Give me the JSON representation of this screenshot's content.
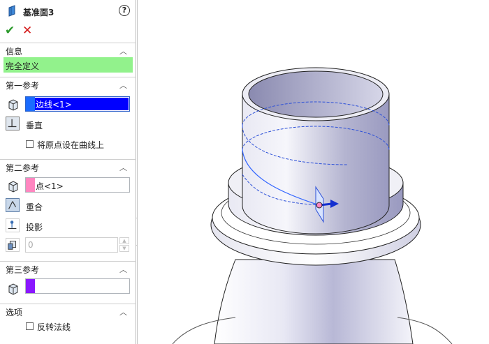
{
  "header": {
    "title": "基准面3",
    "help_icon": "?"
  },
  "actions": {
    "ok_glyph": "✔",
    "cancel_glyph": "✕"
  },
  "sections": {
    "info": {
      "label": "信息",
      "status": "完全定义",
      "status_color": "#92f28c"
    },
    "first_ref": {
      "label": "第一参考",
      "field_value": "边线<1>",
      "swatch_color": "#1a6bff",
      "field_highlight": "#0000ff",
      "constraint": "垂直",
      "checkbox_label": "将原点设在曲线上",
      "checked": false
    },
    "second_ref": {
      "label": "第二参考",
      "field_value": "点<1>",
      "swatch_color": "#ff86c0",
      "constraint_selected": "重合",
      "constraint_other": "投影",
      "distance_value": "0"
    },
    "third_ref": {
      "label": "第三参考",
      "field_value": "",
      "swatch_color": "#8a17ff"
    },
    "options": {
      "label": "选项",
      "checkbox_label": "反转法线",
      "checked": false
    }
  },
  "icons": {
    "section_chevron": "^",
    "plane": "plane-icon",
    "edge": "edge-reference-icon",
    "perpendicular": "perpendicular-icon",
    "coincident": "coincident-icon",
    "project": "project-icon",
    "distance": "distance-icon"
  }
}
